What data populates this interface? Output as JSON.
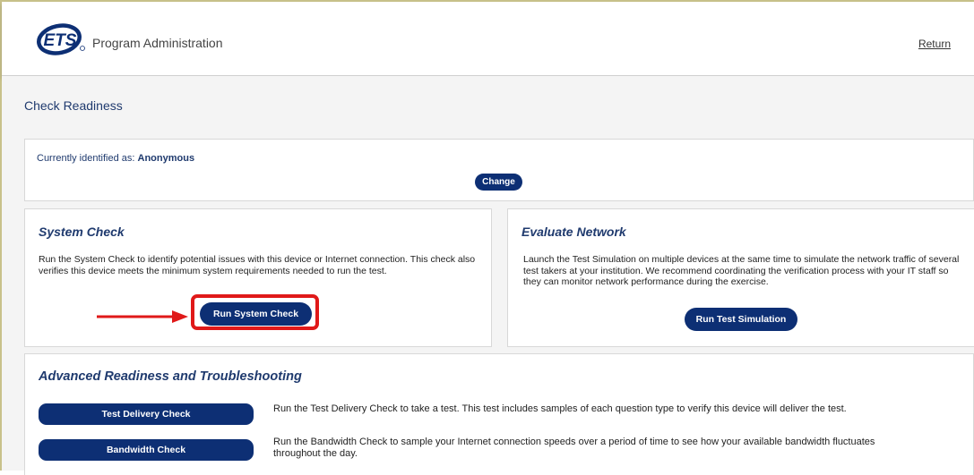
{
  "header": {
    "logo_text": "ETS",
    "app_title": "Program Administration",
    "return_label": "Return"
  },
  "page": {
    "title": "Check Readiness"
  },
  "identity": {
    "label": "Currently identified as:",
    "value": "Anonymous",
    "change_label": "Change"
  },
  "system_check": {
    "heading": "System Check",
    "description": "Run the System Check to identify potential issues with this device or Internet connection. This check also verifies this device meets the minimum system requirements needed to run the test.",
    "button_label": "Run System Check"
  },
  "evaluate_network": {
    "heading": "Evaluate Network",
    "description": "Launch the Test Simulation on multiple devices at the same time to simulate the network traffic of several test takers at your institution. We recommend coordinating the verification process with your IT staff so they can monitor network performance during the exercise.",
    "button_label": "Run Test Simulation"
  },
  "advanced": {
    "heading": "Advanced Readiness and Troubleshooting",
    "items": [
      {
        "button_label": "Test Delivery Check",
        "description": "Run the Test Delivery Check to take a test. This test includes samples of each question type to verify this device will deliver the test."
      },
      {
        "button_label": "Bandwidth Check",
        "description": "Run the Bandwidth Check to sample your Internet connection speeds over a period of time to see how your available bandwidth fluctuates throughout the day."
      }
    ]
  },
  "colors": {
    "primary_button": "#0d2f74",
    "heading_text": "#1f3a6e",
    "highlight": "#e01919",
    "background": "#f4f4f4"
  }
}
